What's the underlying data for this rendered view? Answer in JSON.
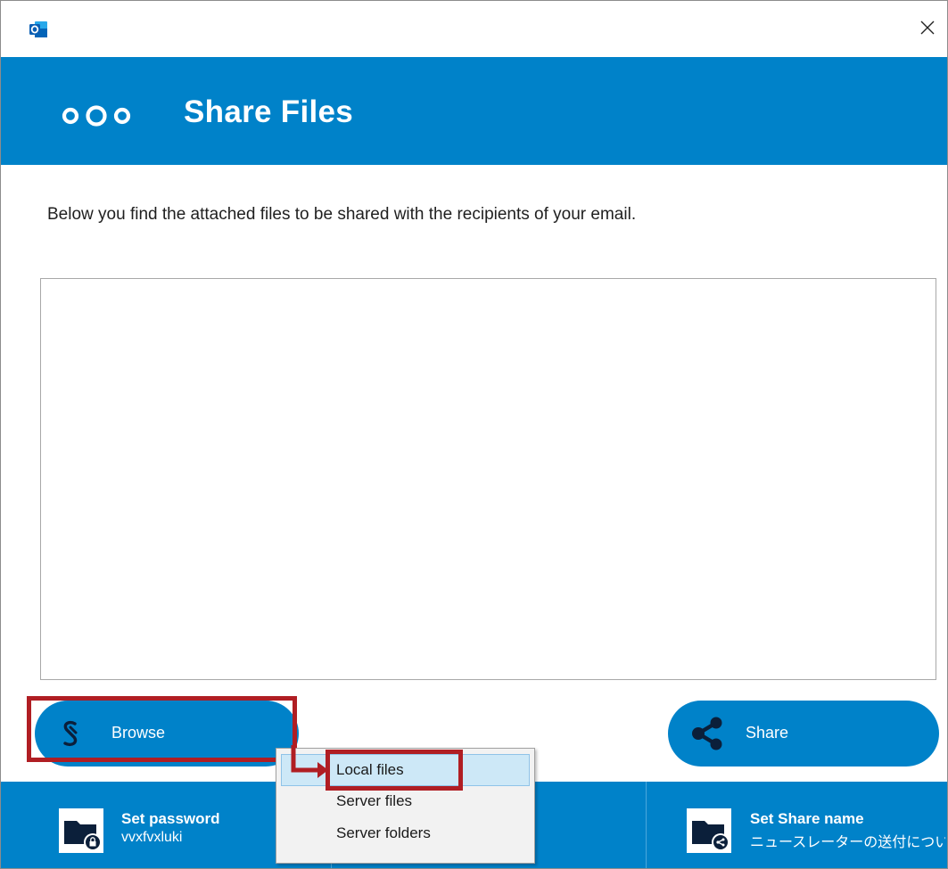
{
  "titlebar": {
    "app_icon": "outlook-icon",
    "close_icon": "close-icon"
  },
  "header": {
    "logo_icon": "nextcloud-logo-icon",
    "title": "Share Files"
  },
  "description": "Below you find the attached files to be shared with the recipients of your email.",
  "file_list": {
    "items": []
  },
  "buttons": {
    "browse": {
      "label": "Browse",
      "icon": "nextcloud-s-icon"
    },
    "share": {
      "label": "Share",
      "icon": "share-icon"
    }
  },
  "context_menu": {
    "items": [
      {
        "label": "Local files",
        "highlighted": true
      },
      {
        "label": "Server files"
      },
      {
        "label": "Server folders"
      }
    ]
  },
  "footer": {
    "password": {
      "title": "Set password",
      "value": "vvxfvxluki",
      "icon": "folder-lock-icon"
    },
    "share_name": {
      "title": "Set Share name",
      "value": "ニュースレーターの送付につい",
      "icon": "folder-share-icon"
    }
  },
  "colors": {
    "brand": "#0082c9",
    "annotation": "#b01e23",
    "menu_highlight": "#cde8f7"
  }
}
